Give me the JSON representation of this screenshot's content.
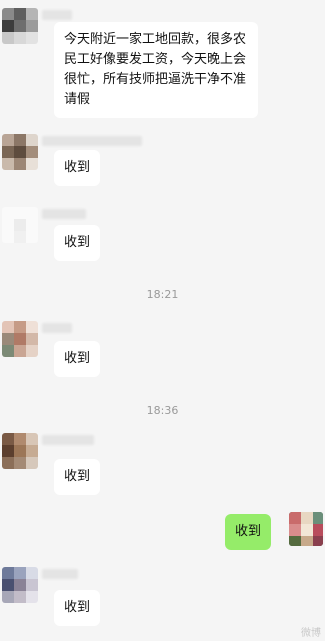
{
  "messages": [
    {
      "text": "今天附近一家工地回款，很多农民工好像要发工资，今天晚上会很忙，所有技师把逼洗干净不准请假"
    },
    {
      "text": "收到"
    },
    {
      "text": "收到"
    },
    {
      "text": "收到"
    },
    {
      "text": "收到"
    },
    {
      "text": "收到"
    },
    {
      "text": "收到"
    }
  ],
  "timestamps": [
    "18:21",
    "18:36"
  ],
  "watermark": "微博",
  "colors": {
    "self_bubble": "#95ec69",
    "other_bubble": "#ffffff",
    "background": "#f5f5f5"
  }
}
